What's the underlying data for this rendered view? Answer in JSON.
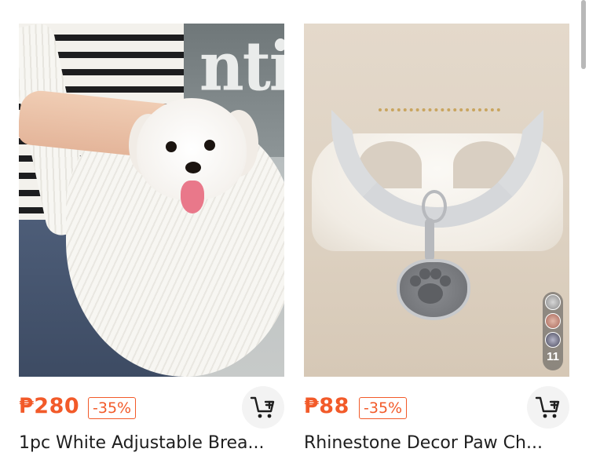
{
  "products": [
    {
      "price": "₱280",
      "discount": "-35%",
      "title": "1pc White Adjustable Brea...",
      "image_desc": "white dog sling carrier with small dog",
      "image_text": "ntic"
    },
    {
      "price": "₱88",
      "discount": "-35%",
      "title": "Rhinestone Decor Paw Ch...",
      "image_desc": "rhinestone collar with paw pendant",
      "color_variant_count": "11"
    }
  ],
  "colors": {
    "accent": "#f25a29",
    "cart_bg": "#f3f3f3",
    "title_text": "#1e1e1e"
  },
  "icons": {
    "cart": "cart-add-icon"
  }
}
